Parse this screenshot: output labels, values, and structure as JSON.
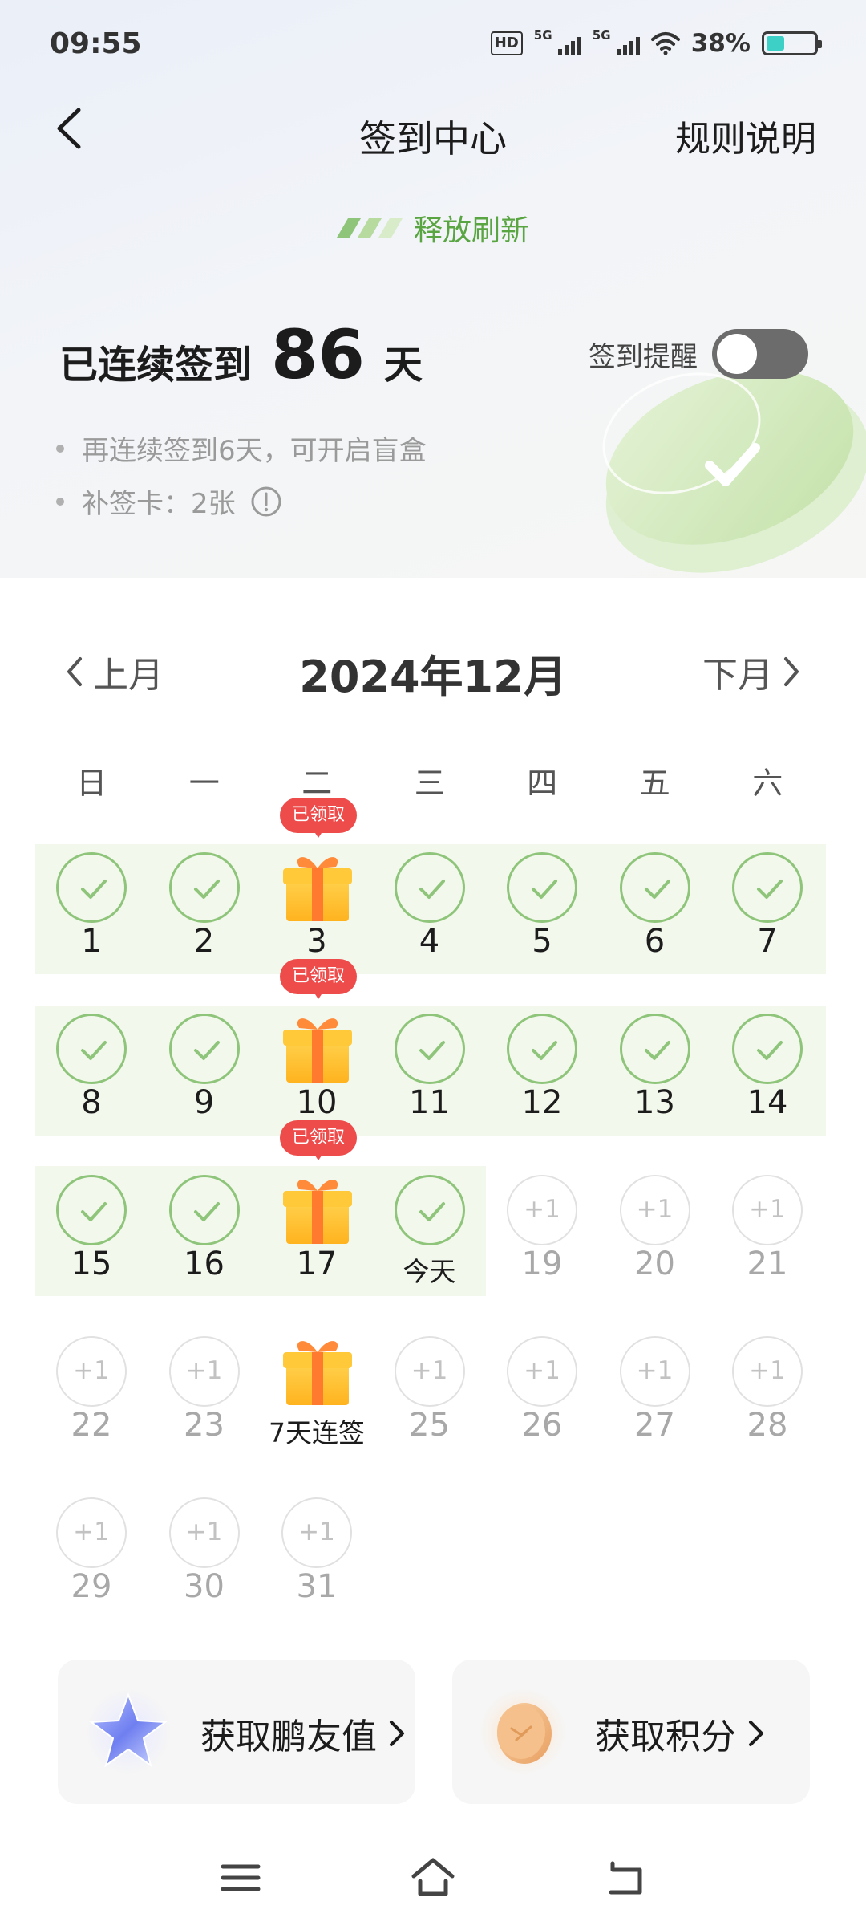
{
  "status_bar": {
    "time": "09:55",
    "net_tag": "HD",
    "sim1_label": "5G",
    "sim2_label": "5G",
    "battery_percent_text": "38%",
    "battery_level": 0.38
  },
  "nav": {
    "title": "签到中心",
    "rules_label": "规则说明"
  },
  "refresh_text": "释放刷新",
  "streak": {
    "label": "已连续签到",
    "days": "86",
    "unit": "天"
  },
  "reminder": {
    "label": "签到提醒",
    "enabled": false
  },
  "tips": [
    "再连续签到6天，可开启盲盒",
    "补签卡：2张"
  ],
  "calendar": {
    "prev_label": "上月",
    "next_label": "下月",
    "month_title": "2024年12月",
    "weekdays": [
      "日",
      "一",
      "二",
      "三",
      "四",
      "五",
      "六"
    ],
    "claimed_label": "已领取",
    "plus_label": "+1",
    "days": [
      {
        "label": "1",
        "state": "done"
      },
      {
        "label": "2",
        "state": "done"
      },
      {
        "label": "3",
        "state": "gift-claimed"
      },
      {
        "label": "4",
        "state": "done"
      },
      {
        "label": "5",
        "state": "done"
      },
      {
        "label": "6",
        "state": "done"
      },
      {
        "label": "7",
        "state": "done"
      },
      {
        "label": "8",
        "state": "done"
      },
      {
        "label": "9",
        "state": "done"
      },
      {
        "label": "10",
        "state": "gift-claimed"
      },
      {
        "label": "11",
        "state": "done"
      },
      {
        "label": "12",
        "state": "done"
      },
      {
        "label": "13",
        "state": "done"
      },
      {
        "label": "14",
        "state": "done"
      },
      {
        "label": "15",
        "state": "done"
      },
      {
        "label": "16",
        "state": "done"
      },
      {
        "label": "17",
        "state": "gift-claimed"
      },
      {
        "label": "今天",
        "state": "today"
      },
      {
        "label": "19",
        "state": "future"
      },
      {
        "label": "20",
        "state": "future"
      },
      {
        "label": "21",
        "state": "future"
      },
      {
        "label": "22",
        "state": "future"
      },
      {
        "label": "23",
        "state": "future"
      },
      {
        "label": "7天连签",
        "state": "gift"
      },
      {
        "label": "25",
        "state": "future"
      },
      {
        "label": "26",
        "state": "future"
      },
      {
        "label": "27",
        "state": "future"
      },
      {
        "label": "28",
        "state": "future"
      },
      {
        "label": "29",
        "state": "future"
      },
      {
        "label": "30",
        "state": "future"
      },
      {
        "label": "31",
        "state": "future"
      }
    ]
  },
  "cards": {
    "friend_value_label": "获取鹏友值",
    "points_label": "获取积分"
  },
  "colors": {
    "accent_green": "#8fc57b",
    "claimed_red": "#ee4b4b",
    "refresh_green": "#59a542"
  }
}
